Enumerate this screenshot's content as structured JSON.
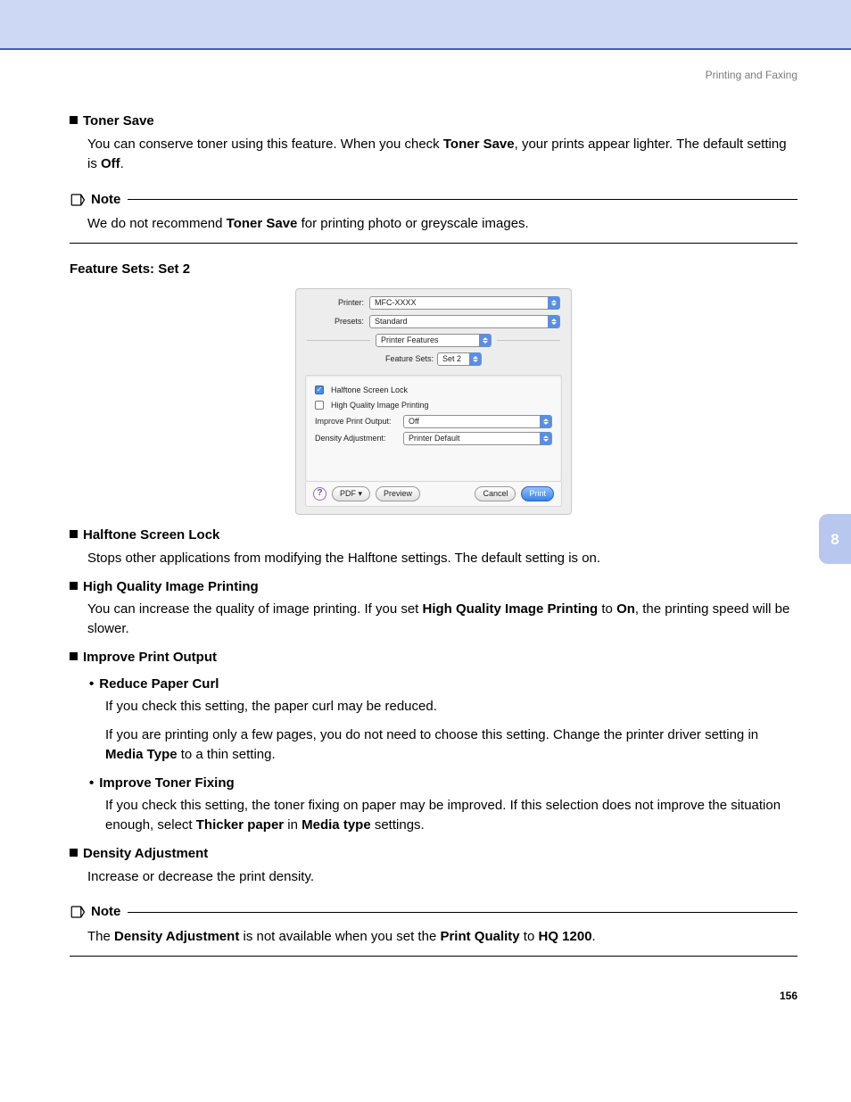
{
  "header": {
    "section": "Printing and Faxing"
  },
  "sidetab": {
    "chapter": "8"
  },
  "pagenum": "156",
  "tonerSave": {
    "title": "Toner Save",
    "p_a": "You can conserve toner using this feature. When you check ",
    "p_b": "Toner Save",
    "p_c": ", your prints appear lighter. The default setting is ",
    "p_d": "Off",
    "p_e": "."
  },
  "note1": {
    "label": "Note",
    "a": "We do not recommend ",
    "b": "Toner Save",
    "c": " for printing photo or greyscale images."
  },
  "featureSetsHeading": "Feature Sets: Set 2",
  "dialog": {
    "printerLabel": "Printer:",
    "printerValue": "MFC-XXXX",
    "presetsLabel": "Presets:",
    "presetsValue": "Standard",
    "paneValue": "Printer Features",
    "featSetsLabel": "Feature Sets:",
    "featSetsValue": "Set 2",
    "halftoneLabel": "Halftone Screen Lock",
    "hqImgLabel": "High Quality Image Printing",
    "improveLabel": "Improve Print Output:",
    "improveValue": "Off",
    "densityLabel": "Density Adjustment:",
    "densityValue": "Printer Default",
    "help": "?",
    "pdf": "PDF ▾",
    "preview": "Preview",
    "cancel": "Cancel",
    "print": "Print"
  },
  "halftone": {
    "title": "Halftone Screen Lock",
    "body": "Stops other applications from modifying the Halftone settings. The default setting is on."
  },
  "hq": {
    "title": "High Quality Image Printing",
    "a": "You can increase the quality of image printing. If you set ",
    "b": "High Quality Image Printing",
    "c": " to ",
    "d": "On",
    "e": ", the printing speed will be slower."
  },
  "improve": {
    "title": "Improve Print Output",
    "reduce": {
      "title": "Reduce Paper Curl",
      "p1": "If you check this setting, the paper curl may be reduced.",
      "p2a": "If you are printing only a few pages, you do not need to choose this setting. Change the printer driver setting in ",
      "p2b": "Media Type",
      "p2c": " to a thin setting."
    },
    "fixing": {
      "title": "Improve Toner Fixing",
      "a": "If you check this setting, the toner fixing on paper may be improved. If this selection does not improve the situation enough, select ",
      "b": "Thicker paper",
      "c": " in ",
      "d": "Media type",
      "e": " settings."
    }
  },
  "density": {
    "title": "Density Adjustment",
    "body": "Increase or decrease the print density."
  },
  "note2": {
    "label": "Note",
    "a": "The ",
    "b": "Density Adjustment",
    "c": " is not available when you set the ",
    "d": "Print Quality",
    "e": " to ",
    "f": "HQ 1200",
    "g": "."
  }
}
